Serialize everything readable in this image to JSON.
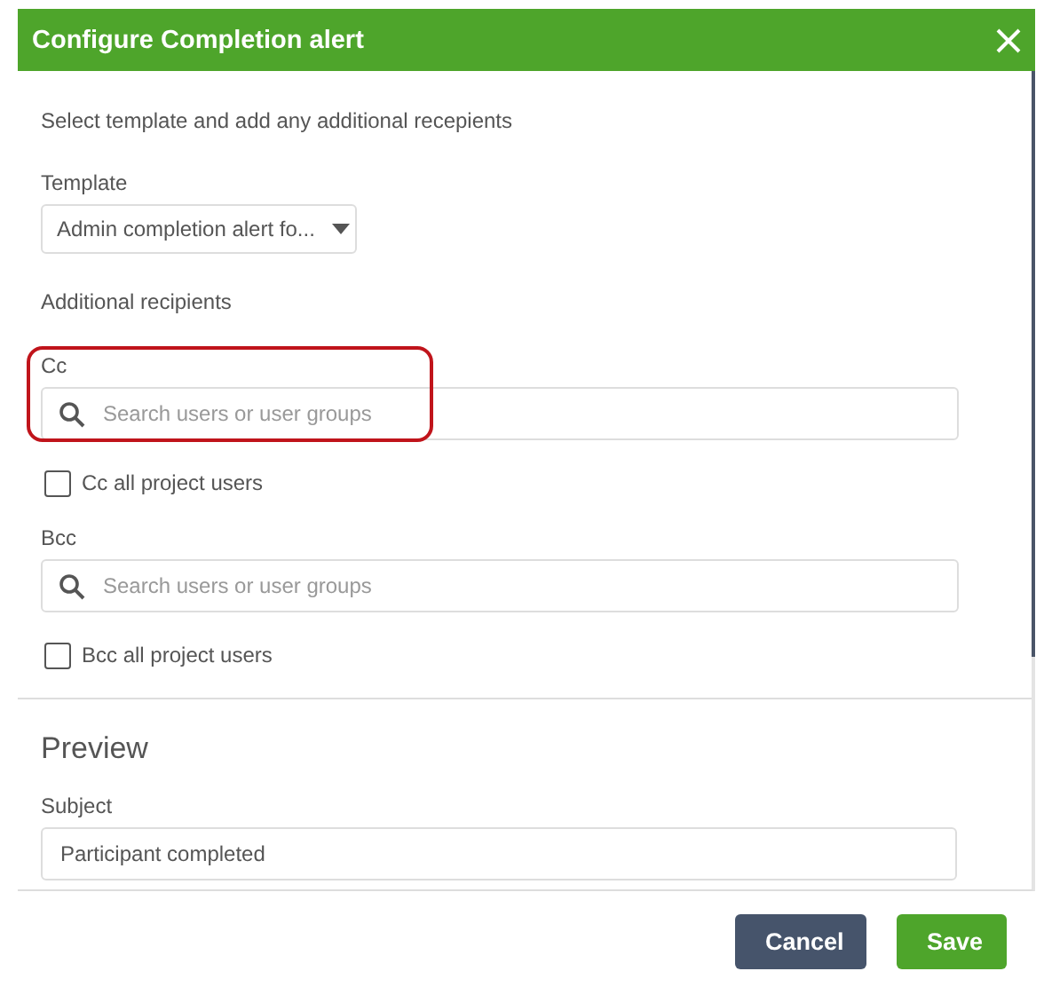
{
  "dialog": {
    "title": "Configure Completion alert"
  },
  "intro": "Select template and add any additional recepients",
  "template": {
    "label": "Template",
    "value": "Admin completion alert fo..."
  },
  "recipients_heading": "Additional recipients",
  "recipient_fields": [
    {
      "label": "Cc",
      "placeholder": "Search users or user groups",
      "highlighted": true,
      "all_users": {
        "label": "Cc all project users",
        "checked": false
      }
    },
    {
      "label": "Bcc",
      "placeholder": "Search users or user groups",
      "highlighted": false,
      "all_users": {
        "label": "Bcc all project users",
        "checked": false
      }
    }
  ],
  "preview": {
    "heading": "Preview",
    "subject_label": "Subject",
    "subject_value": "Participant completed"
  },
  "buttons": [
    {
      "label": "Cancel",
      "kind": "secondary"
    },
    {
      "label": "Save",
      "kind": "primary"
    }
  ]
}
